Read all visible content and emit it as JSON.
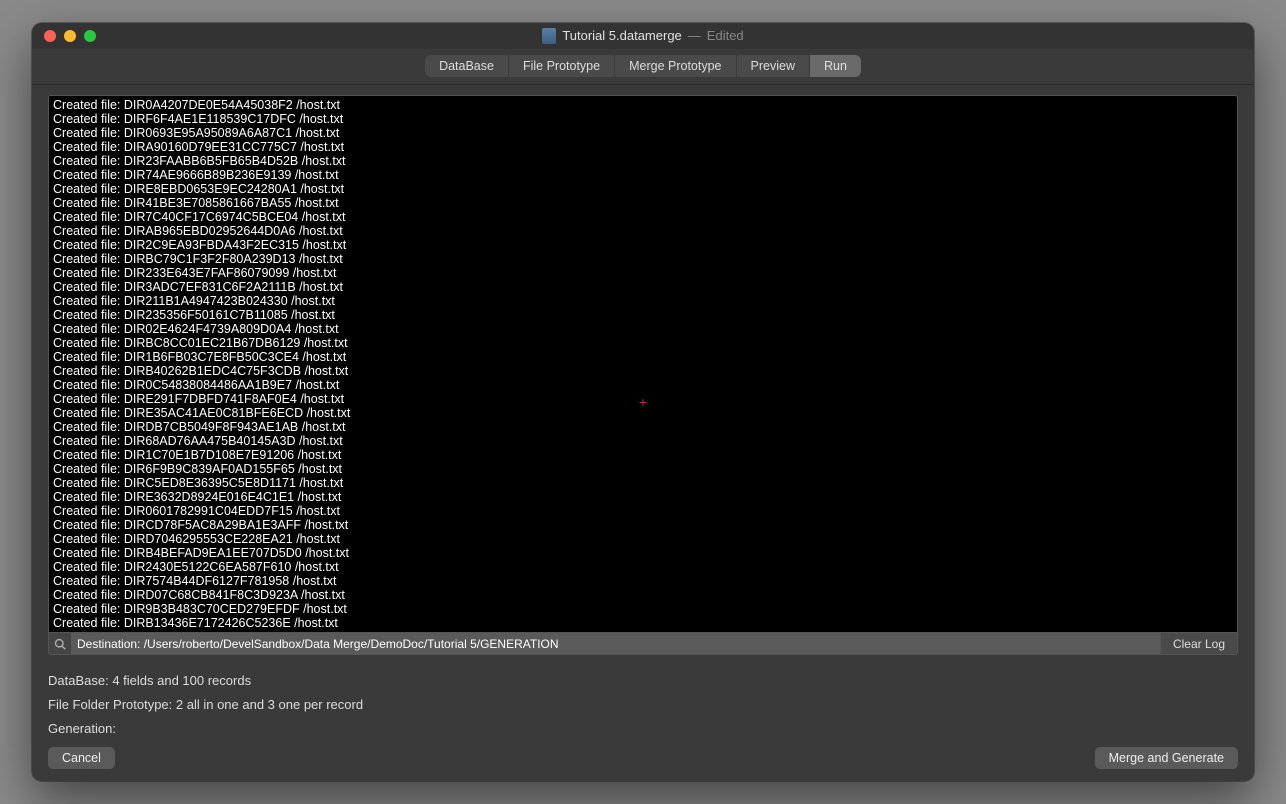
{
  "window": {
    "title": "Tutorial 5.datamerge",
    "edited": "Edited"
  },
  "tabs": [
    {
      "label": "DataBase"
    },
    {
      "label": "File Prototype"
    },
    {
      "label": "Merge Prototype"
    },
    {
      "label": "Preview"
    },
    {
      "label": "Run",
      "active": true
    }
  ],
  "log_lines": [
    "Created file: DIR0A4207DE0E54A45038F2 /host.txt",
    "Created file: DIRF6F4AE1E118539C17DFC /host.txt",
    "Created file: DIR0693E95A95089A6A87C1 /host.txt",
    "Created file: DIRA90160D79EE31CC775C7 /host.txt",
    "Created file: DIR23FAABB6B5FB65B4D52B /host.txt",
    "Created file: DIR74AE9666B89B236E9139 /host.txt",
    "Created file: DIRE8EBD0653E9EC24280A1 /host.txt",
    "Created file: DIR41BE3E7085861667BA55 /host.txt",
    "Created file: DIR7C40CF17C6974C5BCE04 /host.txt",
    "Created file: DIRAB965EBD02952644D0A6 /host.txt",
    "Created file: DIR2C9EA93FBDA43F2EC315 /host.txt",
    "Created file: DIRBC79C1F3F2F80A239D13 /host.txt",
    "Created file: DIR233E643E7FAF86079099 /host.txt",
    "Created file: DIR3ADC7EF831C6F2A2111B /host.txt",
    "Created file: DIR211B1A4947423B024330 /host.txt",
    "Created file: DIR235356F50161C7B11085 /host.txt",
    "Created file: DIR02E4624F4739A809D0A4 /host.txt",
    "Created file: DIRBC8CC01EC21B67DB6129 /host.txt",
    "Created file: DIR1B6FB03C7E8FB50C3CE4 /host.txt",
    "Created file: DIRB40262B1EDC4C75F3CDB /host.txt",
    "Created file: DIR0C54838084486AA1B9E7 /host.txt",
    "Created file: DIRE291F7DBFD741F8AF0E4 /host.txt",
    "Created file: DIRE35AC41AE0C81BFE6ECD /host.txt",
    "Created file: DIRDB7CB5049F8F943AE1AB /host.txt",
    "Created file: DIR68AD76AA475B40145A3D /host.txt",
    "Created file: DIR1C70E1B7D108E7E91206 /host.txt",
    "Created file: DIR6F9B9C839AF0AD155F65 /host.txt",
    "Created file: DIRC5ED8E36395C5E8D1171 /host.txt",
    "Created file: DIRE3632D8924E016E4C1E1 /host.txt",
    "Created file: DIR0601782991C04EDD7F15 /host.txt",
    "Created file: DIRCD78F5AC8A29BA1E3AFF /host.txt",
    "Created file: DIRD7046295553CE228EA21 /host.txt",
    "Created file: DIRB4BEFAD9EA1EE707D5D0 /host.txt",
    "Created file: DIR2430E5122C6EA587F610 /host.txt",
    "Created file: DIR7574B44DF6127F781958 /host.txt",
    "Created file: DIRD07C68CB841F8C3D923A /host.txt",
    "Created file: DIR9B3B483C70CED279EFDF /host.txt",
    "Created file: DIRB13436E7172426C5236E /host.txt"
  ],
  "search": {
    "value": "Destination: /Users/roberto/DevelSandbox/Data Merge/DemoDoc/Tutorial 5/GENERATION",
    "clear_log": "Clear Log"
  },
  "info": {
    "database": "DataBase:  4 fields and 100 records",
    "prototype": "File Folder Prototype: 2 all in one and 3 one per record",
    "generation": "Generation:"
  },
  "buttons": {
    "cancel": "Cancel",
    "merge": "Merge and Generate"
  }
}
